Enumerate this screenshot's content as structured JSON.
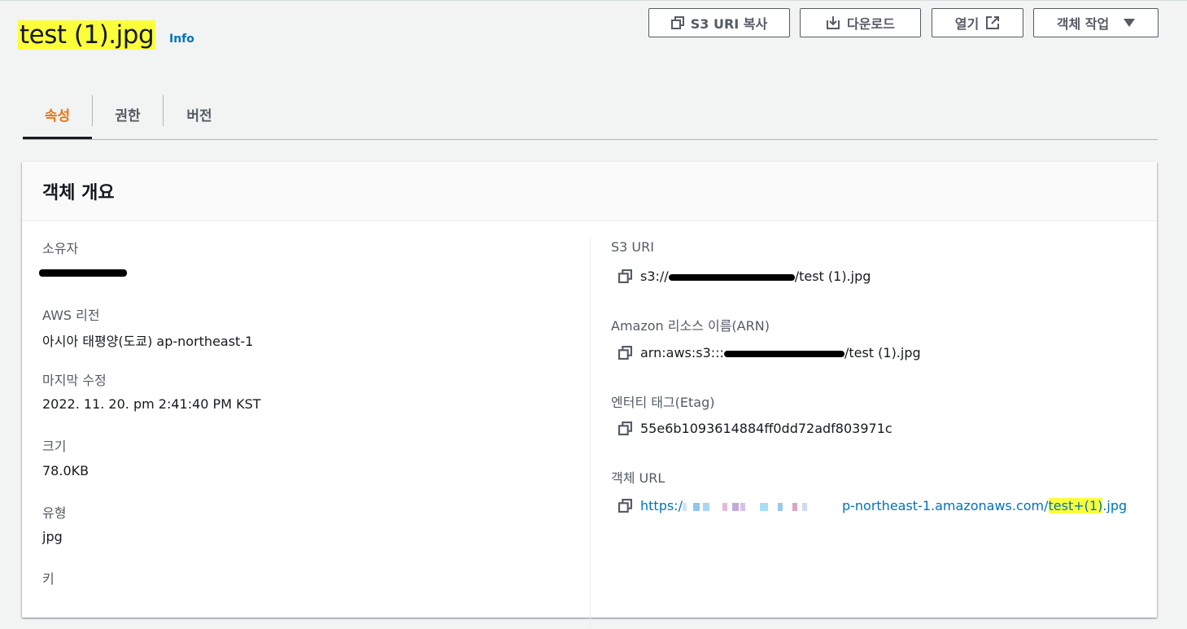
{
  "header": {
    "title": "test (1).jpg",
    "info_label": "Info"
  },
  "actions": {
    "copy_uri_label": "S3 URI 복사",
    "download_label": "다운로드",
    "open_label": "열기",
    "object_actions_label": "객체 작업"
  },
  "tabs": [
    {
      "label": "속성",
      "active": true
    },
    {
      "label": "권한",
      "active": false
    },
    {
      "label": "버전",
      "active": false
    }
  ],
  "overview": {
    "title": "객체 개요",
    "owner_label": "소유자",
    "region_label": "AWS 리전",
    "region_value": "아시아 태평양(도쿄) ap-northeast-1",
    "modified_label": "마지막 수정",
    "modified_value": "2022. 11. 20. pm 2:41:40 PM KST",
    "size_label": "크기",
    "size_value": "78.0KB",
    "type_label": "유형",
    "type_value": "jpg",
    "key_label": "키",
    "s3uri_label": "S3 URI",
    "s3uri_prefix": "s3://",
    "s3uri_suffix": "/test (1).jpg",
    "arn_label": "Amazon 리소스 이름(ARN)",
    "arn_prefix": "arn:aws:s3:::",
    "arn_suffix": "/test (1).jpg",
    "etag_label": "엔터티 태그(Etag)",
    "etag_value": "55e6b1093614884ff0dd72adf803971c",
    "url_label": "객체 URL",
    "url_prefix": "https:/",
    "url_middle": "p-northeast-1.amazonaws.com/",
    "url_highlight": "test+(1)",
    "url_suffix": ".jpg"
  },
  "colors": {
    "accent_orange": "#ec7211",
    "link_blue": "#0073bb",
    "highlight_yellow": "#fbff3a"
  }
}
